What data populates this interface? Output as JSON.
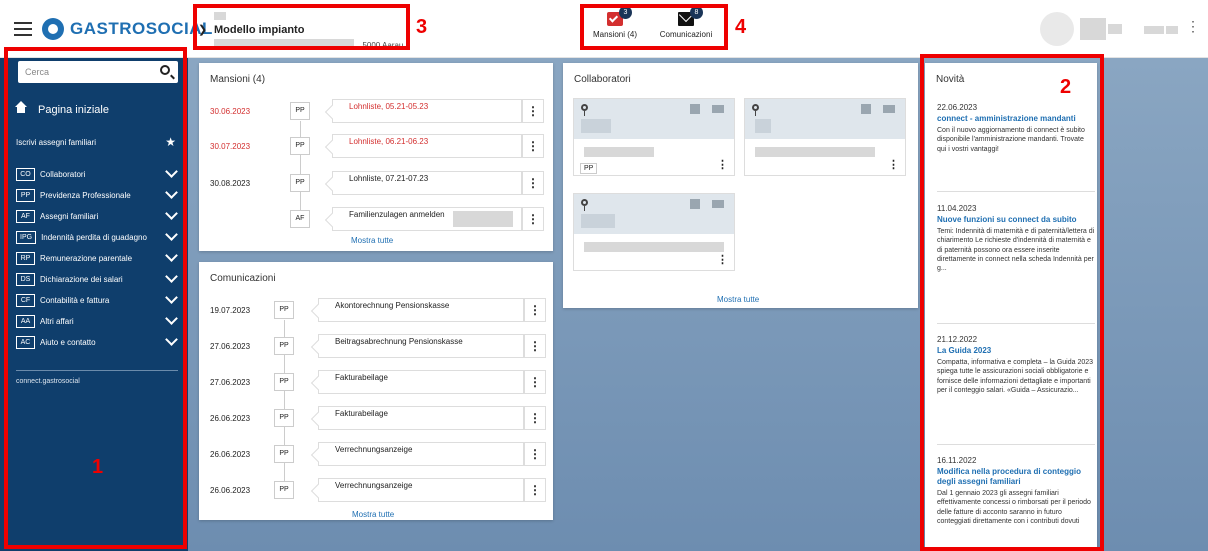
{
  "brand": {
    "name": "GASTROSOCIAL"
  },
  "header": {
    "plant_title": "Modello impianto",
    "plant_address": ", 5000 Aarau",
    "tasks_label": "Mansioni (4)",
    "tasks_badge": "3",
    "messages_label": "Comunicazioni",
    "messages_badge": "8"
  },
  "sidebar": {
    "search_placeholder": "Cerca",
    "home": "Pagina iniziale",
    "enroll": "Iscrivi assegni familiari",
    "items": [
      {
        "code": "CO",
        "label": "Collaboratori"
      },
      {
        "code": "PP",
        "label": "Previdenza Professionale"
      },
      {
        "code": "AF",
        "label": "Assegni familiari"
      },
      {
        "code": "IPG",
        "label": "Indennità perdita di guadagno"
      },
      {
        "code": "RP",
        "label": "Remunerazione parentale"
      },
      {
        "code": "DS",
        "label": "Dichiarazione dei salari"
      },
      {
        "code": "CF",
        "label": "Contabilità e fattura"
      },
      {
        "code": "AA",
        "label": "Altri affari"
      },
      {
        "code": "AC",
        "label": "Aiuto e contatto"
      }
    ],
    "footer": "connect.gastrosocial"
  },
  "tasks": {
    "title": "Mansioni (4)",
    "show_all": "Mostra tutte",
    "rows": [
      {
        "date": "30.06.2023",
        "code": "PP",
        "text": "Lohnliste, 05.21-05.23",
        "overdue": true
      },
      {
        "date": "30.07.2023",
        "code": "PP",
        "text": "Lohnliste, 06.21-06.23",
        "overdue": true
      },
      {
        "date": "30.08.2023",
        "code": "PP",
        "text": "Lohnliste, 07.21-07.23",
        "overdue": false
      },
      {
        "date": "",
        "code": "AF",
        "text": "Familienzulagen anmelden",
        "overdue": false
      }
    ]
  },
  "messages": {
    "title": "Comunicazioni",
    "show_all": "Mostra tutte",
    "rows": [
      {
        "date": "19.07.2023",
        "code": "PP",
        "text": "Akontorechnung Pensionskasse"
      },
      {
        "date": "27.06.2023",
        "code": "PP",
        "text": "Beitragsabrechnung Pensionskasse"
      },
      {
        "date": "27.06.2023",
        "code": "PP",
        "text": "Fakturabeilage"
      },
      {
        "date": "26.06.2023",
        "code": "PP",
        "text": "Fakturabeilage"
      },
      {
        "date": "26.06.2023",
        "code": "PP",
        "text": "Verrechnungsanzeige"
      },
      {
        "date": "26.06.2023",
        "code": "PP",
        "text": "Verrechnungsanzeige"
      }
    ]
  },
  "employees": {
    "title": "Collaboratori",
    "show_all": "Mostra tutte",
    "pp_tag": "PP"
  },
  "news": {
    "title": "Novità",
    "items": [
      {
        "date": "22.06.2023",
        "title": "connect - amministrazione mandanti",
        "text": "Con il nuovo aggiornamento di connect è subito disponibile l'amministrazione mandanti. Trovate qui i vostri vantaggi!"
      },
      {
        "date": "11.04.2023",
        "title": "Nuove funzioni su connect da subito",
        "text": "Temi: Indennità di maternità e di paternità/lettera di chiarimento Le richieste d'indennità di maternità e di paternità possono ora essere inserite direttamente in connect nella scheda Indennità per g..."
      },
      {
        "date": "21.12.2022",
        "title": "La Guida 2023",
        "text": "Compatta, informativa e completa – la Guida 2023 spiega tutte le assicurazioni sociali obbligatorie e fornisce delle informazioni dettagliate e importanti per il conteggio salari. «Guida – Assicurazio..."
      },
      {
        "date": "16.11.2022",
        "title": "Modifica nella procedura di conteggio degli assegni familiari",
        "text": "Dal 1 gennaio 2023 gli assegni familiari effettivamente concessi o rimborsati per il periodo delle fatture di acconto saranno in futuro conteggiati direttamente con i contributi dovuti"
      }
    ]
  },
  "annotations": [
    "1",
    "2",
    "3",
    "4"
  ],
  "colors": {
    "sidebar": "#0f3e6c",
    "accent": "#1f6fb2",
    "overdue": "#d32f2f",
    "annotation": "#ee0000"
  }
}
